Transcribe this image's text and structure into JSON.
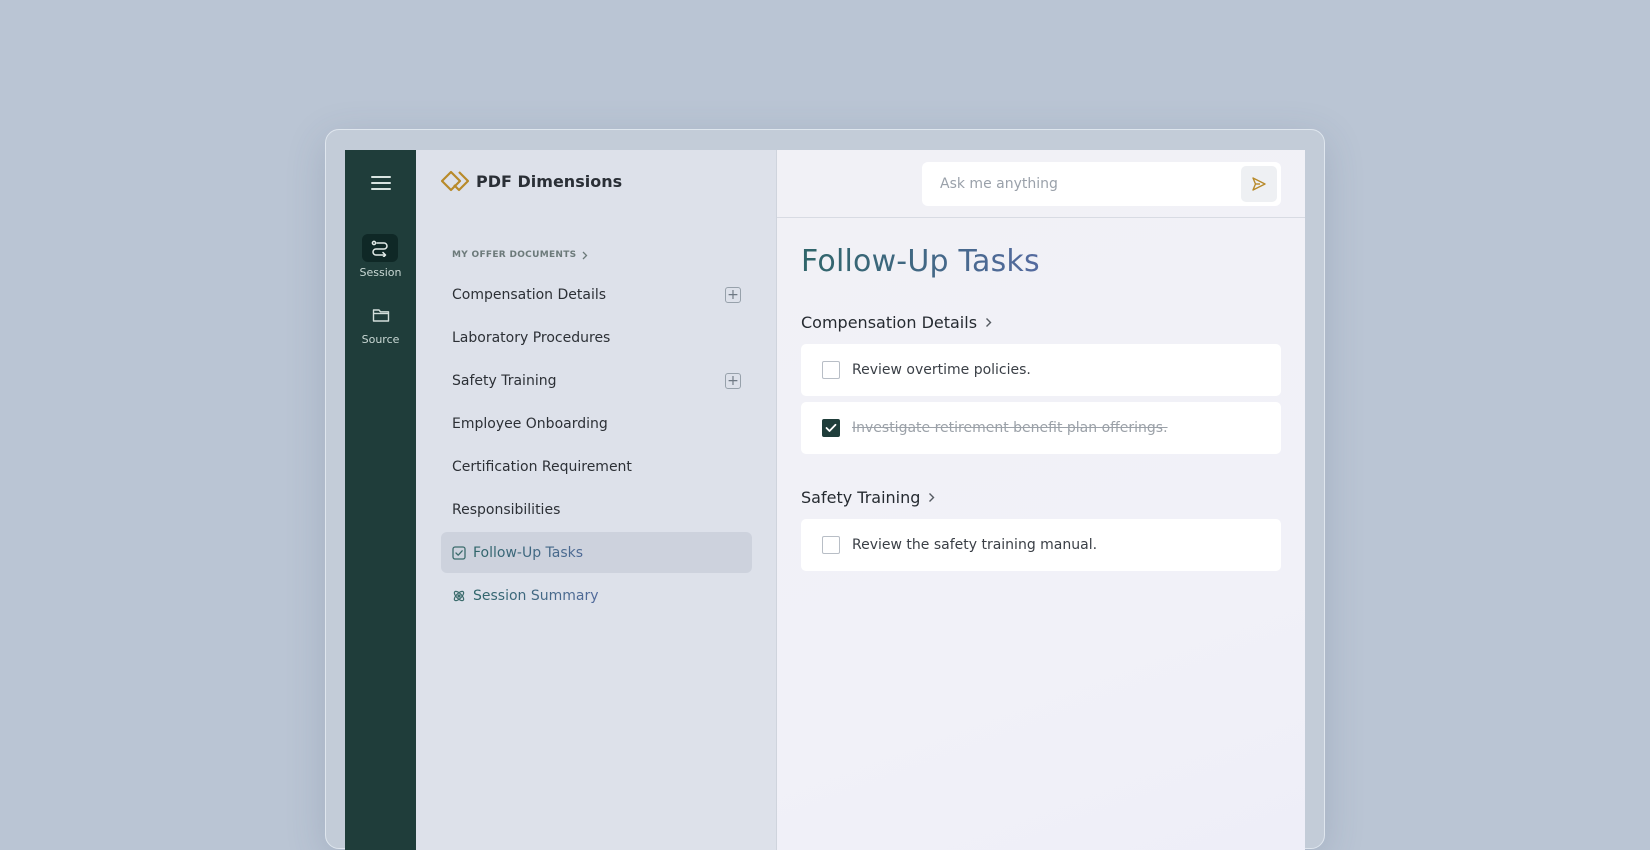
{
  "rail": {
    "items": [
      {
        "label": "Session",
        "icon": "session-icon",
        "active": true
      },
      {
        "label": "Source",
        "icon": "folder-icon",
        "active": false
      }
    ]
  },
  "brand": {
    "name": "PDF Dimensions",
    "logo_color": "#b88a2a"
  },
  "nav": {
    "breadcrumb": "MY OFFER DOCUMENTS",
    "items": [
      {
        "label": "Compensation Details",
        "expandable": true
      },
      {
        "label": "Laboratory Procedures"
      },
      {
        "label": "Safety Training",
        "expandable": true
      },
      {
        "label": "Employee Onboarding"
      },
      {
        "label": "Certification Requirement"
      },
      {
        "label": "Responsibilities"
      },
      {
        "label": "Follow-Up Tasks",
        "icon": "checkbox-icon",
        "active": true
      },
      {
        "label": "Session Summary",
        "icon": "atom-icon"
      }
    ]
  },
  "search": {
    "placeholder": "Ask me anything"
  },
  "main": {
    "title": "Follow-Up Tasks",
    "sections": [
      {
        "title": "Compensation Details",
        "tasks": [
          {
            "text": "Review overtime policies.",
            "done": false
          },
          {
            "text": "Investigate retirement benefit plan offerings.",
            "done": true
          }
        ]
      },
      {
        "title": "Safety Training",
        "tasks": [
          {
            "text": "Review the safety training manual.",
            "done": false
          }
        ]
      }
    ]
  },
  "colors": {
    "rail_bg": "#1f3d3a",
    "title_gradient_start": "#2f6569",
    "title_gradient_end": "#7a70d6",
    "checked_fill": "#1f3d3a"
  }
}
